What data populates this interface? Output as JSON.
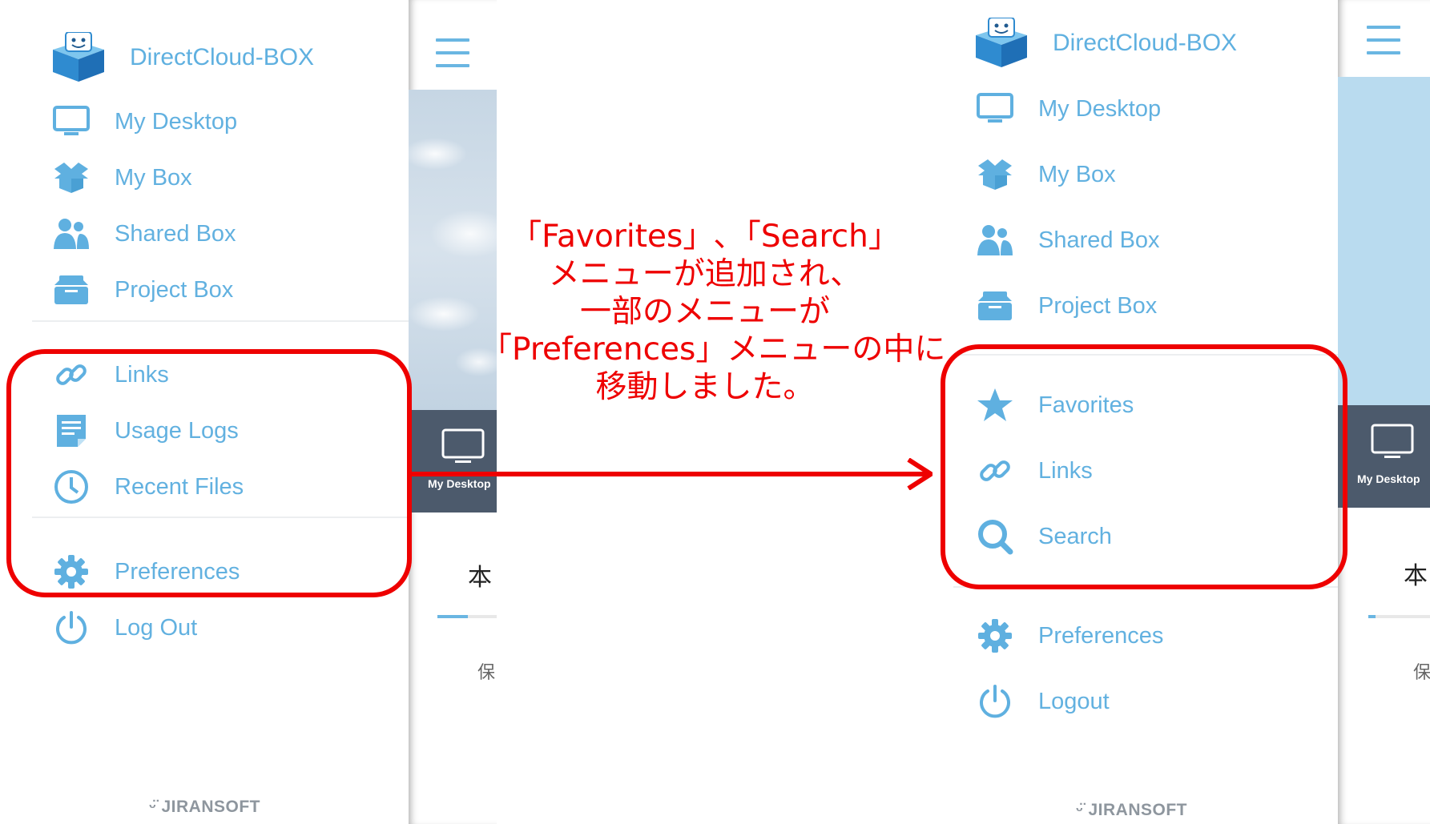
{
  "before": {
    "brand": "DirectCloud-BOX",
    "menu": [
      {
        "label": "My Desktop",
        "icon": "monitor-icon"
      },
      {
        "label": "My Box",
        "icon": "open-box-icon"
      },
      {
        "label": "Shared Box",
        "icon": "users-icon"
      },
      {
        "label": "Project Box",
        "icon": "archive-box-icon"
      },
      {
        "label": "Links",
        "icon": "link-icon"
      },
      {
        "label": "Usage Logs",
        "icon": "document-icon"
      },
      {
        "label": "Recent Files",
        "icon": "clock-icon"
      },
      {
        "label": "Preferences",
        "icon": "gear-icon"
      },
      {
        "label": "Log Out",
        "icon": "power-icon"
      }
    ],
    "footer": "JIRANSOFT",
    "peek": {
      "tab_label": "My Desktop",
      "char_1": "本",
      "char_2": "保"
    }
  },
  "after": {
    "brand": "DirectCloud-BOX",
    "menu": [
      {
        "label": "My Desktop",
        "icon": "monitor-icon"
      },
      {
        "label": "My Box",
        "icon": "open-box-icon"
      },
      {
        "label": "Shared Box",
        "icon": "users-icon"
      },
      {
        "label": "Project Box",
        "icon": "archive-box-icon"
      },
      {
        "label": "Favorites",
        "icon": "star-icon"
      },
      {
        "label": "Links",
        "icon": "link-icon"
      },
      {
        "label": "Search",
        "icon": "search-icon"
      },
      {
        "label": "Preferences",
        "icon": "gear-icon"
      },
      {
        "label": "Logout",
        "icon": "power-icon"
      }
    ],
    "footer": "JIRANSOFT",
    "peek": {
      "tab_label": "My Desktop",
      "char_1": "本",
      "char_2": "保"
    }
  },
  "annotation": {
    "lines": [
      "「Favorites」､「Search」",
      "メニューが追加され、",
      "一部のメニューが",
      "「Preferences」メニューの中に",
      "移動しました。"
    ]
  },
  "colors": {
    "accent": "#5fb0e0",
    "highlight": "#ee0000",
    "dark_bar": "#4c5a6c"
  }
}
